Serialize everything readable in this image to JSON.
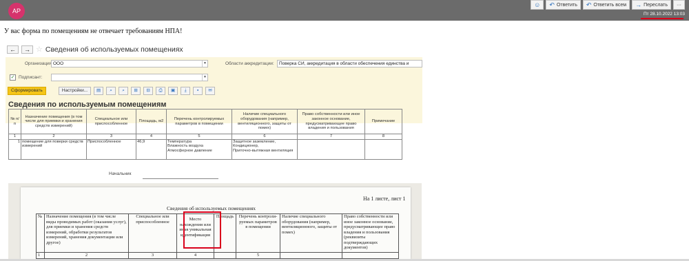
{
  "header": {
    "avatar": "АР",
    "buttons": [
      {
        "icon": "smiley-icon",
        "label": ""
      },
      {
        "icon": "reply-icon",
        "label": "Ответить"
      },
      {
        "icon": "reply-all-icon",
        "label": "Ответить всем"
      },
      {
        "icon": "forward-icon",
        "label": "Переслать"
      },
      {
        "icon": "more-icon",
        "label": "···"
      }
    ],
    "datetime": "Пт 28.10.2022 13:03"
  },
  "message": "У вас форма по помещениям не отвечает требованиям НПА!",
  "screenshot1": {
    "title": "Сведения об используемых помещениях",
    "org_label": "Организация:",
    "org_value": "ООО",
    "accr_label": "Области аккредитации:",
    "accr_value": "Поверка СИ, аккредитация в области обеспечения единства и",
    "signer_label": "Подписант:",
    "generate": "Сформировать",
    "settings": "Настройки...",
    "report_title": "Сведения по используемым помещениям",
    "headers": [
      "№ п/п",
      "Назначение помещения (в том числе для приемки и хранения средств измерений)",
      "Специальное или приспособленное",
      "Площадь, м2",
      "Перечень контролируемых параметров в помещении",
      "Наличие специального оборудования (например, вентиляционного, защиты от помех)",
      "Право собственности или иное законное основание, предусматривающее право владения и пользования",
      "Примечание"
    ],
    "numbers": [
      "1",
      "2",
      "3",
      "4",
      "5",
      "6",
      "7",
      "8"
    ],
    "row": [
      "1",
      "помещение для поверки средств измерений",
      "Приспособленное",
      "46,9",
      "Температура\nВлажность воздуха\nАтмосферное давление",
      "Защитное заземление,\nКондиционер,\nПриточно-вытяжная вентиляция",
      "",
      ""
    ],
    "chief": "Начальник"
  },
  "screenshot2": {
    "sheet": "На 1 листе, лист 1",
    "title": "Сведения об используемых помещениях",
    "headers": [
      "№",
      "Назначение помещения (в том числе виды проводимых работ (оказания услуг), для приемки и хранения средств измерений, обработки результатов измерений, хранения документации или другое)",
      "Специальное или приспособленное",
      "Место нахождения или иная уникальная идентификация",
      "Площадь",
      "Перечень контроли-руемых параметров в помещении",
      "Наличие специального оборудования (например, вентиляционного, защиты от помех)",
      "Право собственности или иное законное основание, предусматривающее право владения и пользования (реквизиты подтверждающих документов)"
    ],
    "numbers": [
      "1",
      "2",
      "3",
      "4",
      "",
      "5",
      "",
      ""
    ]
  }
}
